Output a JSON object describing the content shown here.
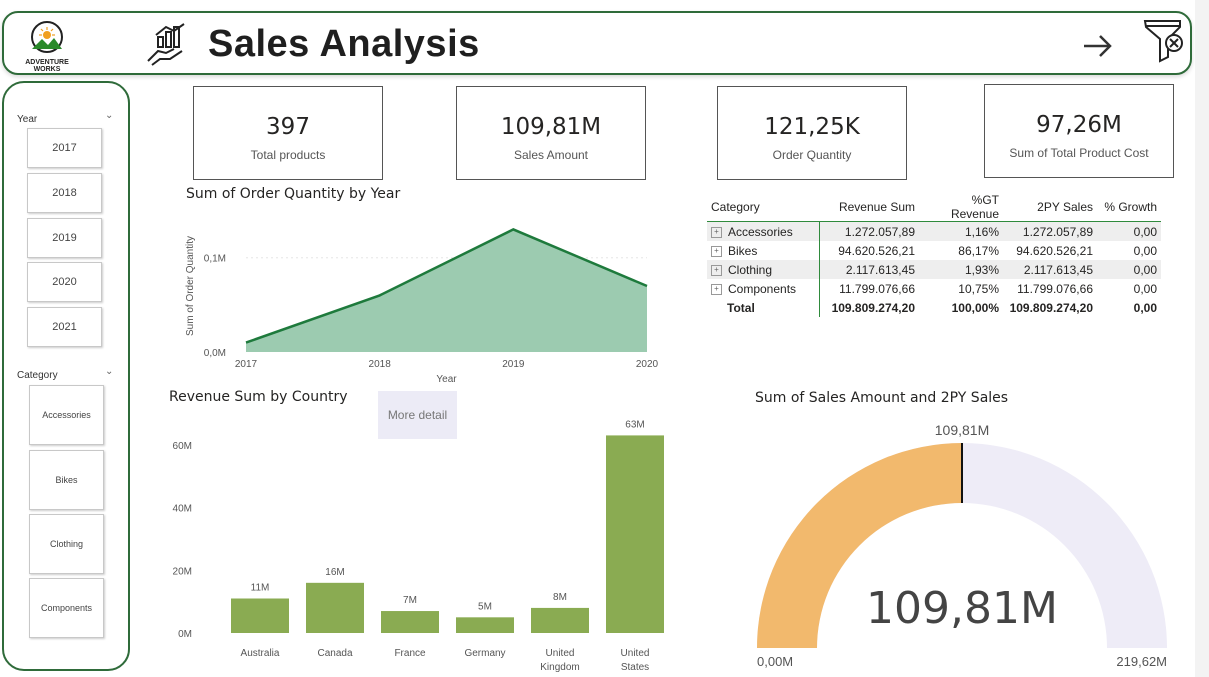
{
  "header": {
    "title": "Sales Analysis",
    "logo_text_line1": "Adventure",
    "logo_text_line2": "Works",
    "accent_color": "#2f6b3a"
  },
  "sidebar": {
    "year_label": "Year",
    "years": [
      "2017",
      "2018",
      "2019",
      "2020",
      "2021"
    ],
    "category_label": "Category",
    "categories": [
      "Accessories",
      "Bikes",
      "Clothing",
      "Components"
    ]
  },
  "kpis": [
    {
      "value": "397",
      "label": "Total products"
    },
    {
      "value": "109,81M",
      "label": "Sales Amount"
    },
    {
      "value": "121,25K",
      "label": "Order Quantity"
    },
    {
      "value": "97,26M",
      "label": "Sum of Total Product Cost"
    }
  ],
  "area_chart": {
    "title": "Sum of Order Quantity by Year",
    "xlabel": "Year",
    "ylabel": "Sum of Order Quantity",
    "y_ticks": [
      "0,1M",
      "0,0M"
    ],
    "x_ticks": [
      "2017",
      "2018",
      "2019",
      "2020"
    ],
    "fill_color": "#9ccbb0",
    "line_color": "#1e7a3c"
  },
  "matrix": {
    "headers": [
      "Category",
      "Revenue Sum",
      "%GT Revenue",
      "2PY Sales",
      "% Growth"
    ],
    "rows": [
      {
        "category": "Accessories",
        "revenue": "1.272.057,89",
        "gt": "1,16%",
        "py2": "1.272.057,89",
        "growth": "0,00"
      },
      {
        "category": "Bikes",
        "revenue": "94.620.526,21",
        "gt": "86,17%",
        "py2": "94.620.526,21",
        "growth": "0,00"
      },
      {
        "category": "Clothing",
        "revenue": "2.117.613,45",
        "gt": "1,93%",
        "py2": "2.117.613,45",
        "growth": "0,00"
      },
      {
        "category": "Components",
        "revenue": "11.799.076,66",
        "gt": "10,75%",
        "py2": "11.799.076,66",
        "growth": "0,00"
      }
    ],
    "total": {
      "category": "Total",
      "revenue": "109.809.274,20",
      "gt": "100,00%",
      "py2": "109.809.274,20",
      "growth": "0,00"
    }
  },
  "bar_chart": {
    "title": "Revenue Sum by Country",
    "more_detail": "More detail",
    "y_ticks": [
      "60M",
      "40M",
      "20M",
      "0M"
    ],
    "bar_color": "#8aab52"
  },
  "gauge": {
    "title": "Sum of Sales Amount and 2PY Sales",
    "value_label": "109,81M",
    "target_label": "109,81M",
    "min_label": "0,00M",
    "max_label": "219,62M",
    "fill_color": "#f2b96d",
    "track_color": "#eeecf7"
  },
  "chart_data": [
    {
      "type": "area",
      "title": "Sum of Order Quantity by Year",
      "xlabel": "Year",
      "ylabel": "Sum of Order Quantity",
      "x": [
        "2017",
        "2018",
        "2019",
        "2020"
      ],
      "values": [
        0.01,
        0.06,
        0.13,
        0.07
      ],
      "unit": "M",
      "ylim": [
        0,
        0.14
      ]
    },
    {
      "type": "bar",
      "title": "Revenue Sum by Country",
      "categories": [
        "Australia",
        "Canada",
        "France",
        "Germany",
        "United Kingdom",
        "United States"
      ],
      "values": [
        11,
        16,
        7,
        5,
        8,
        63
      ],
      "data_labels": [
        "11M",
        "16M",
        "7M",
        "5M",
        "8M",
        "63M"
      ],
      "unit": "M",
      "ylim": [
        0,
        66
      ]
    },
    {
      "type": "gauge",
      "title": "Sum of Sales Amount and 2PY Sales",
      "value": 109.81,
      "target": 109.81,
      "min": 0,
      "max": 219.62,
      "unit": "M"
    }
  ]
}
